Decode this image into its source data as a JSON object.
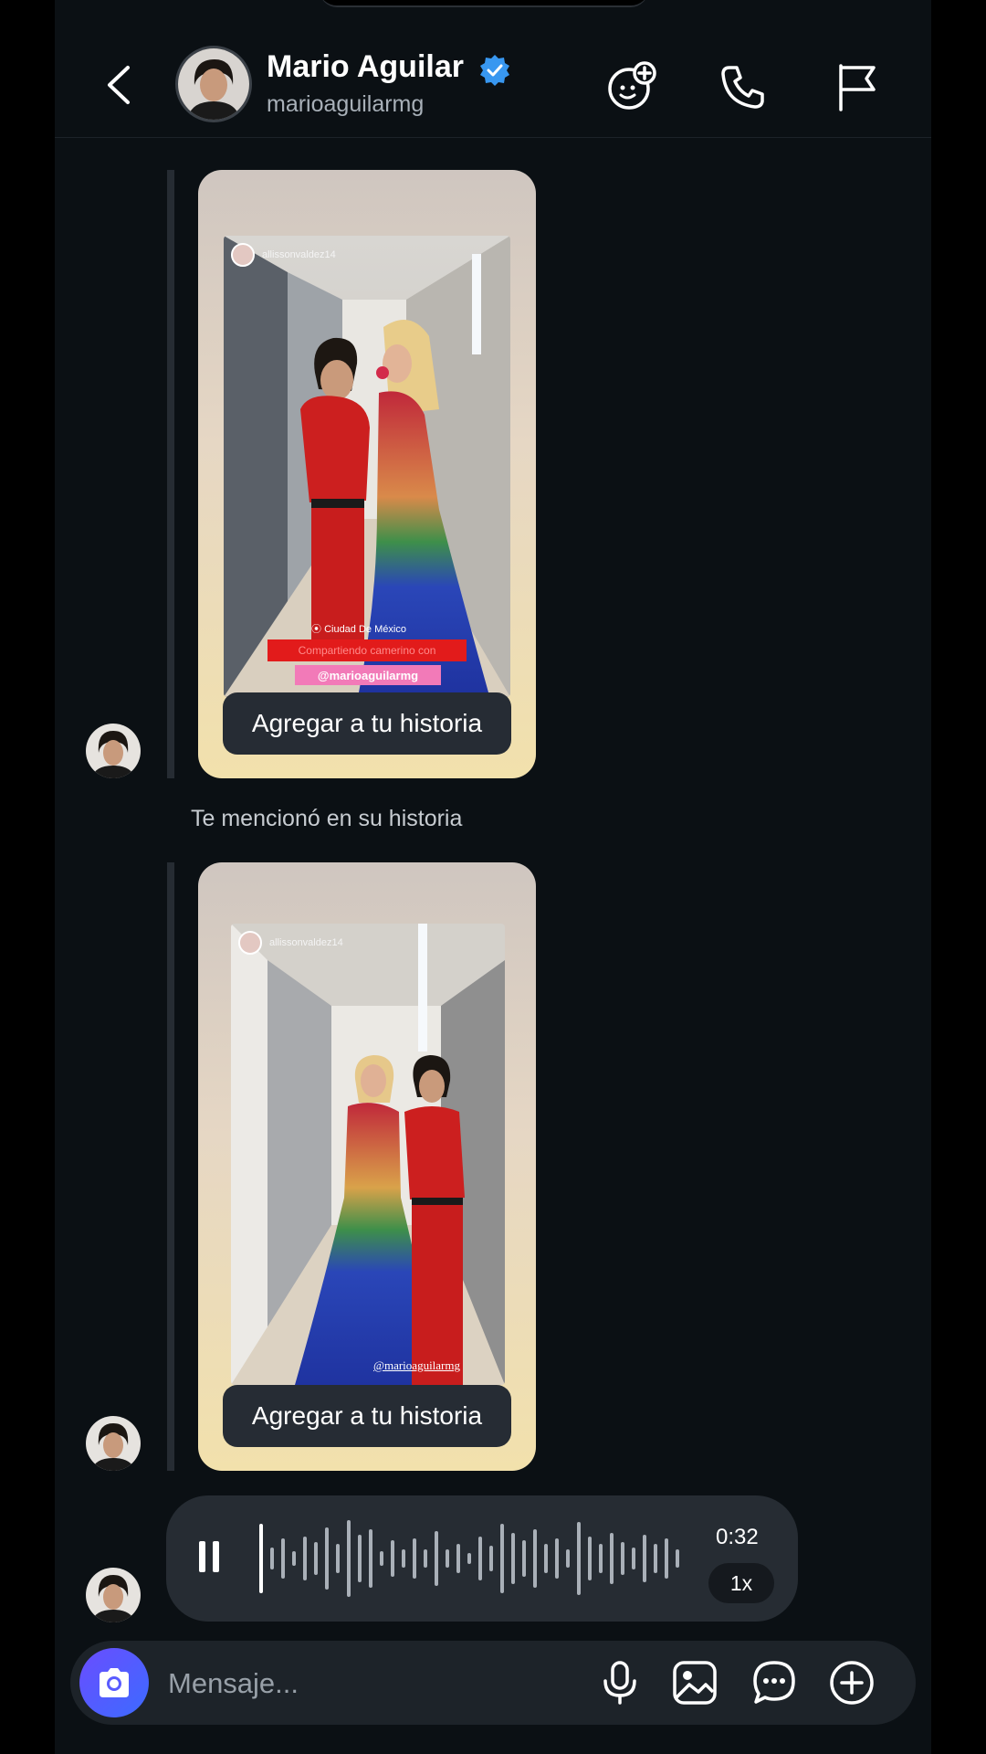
{
  "header": {
    "name": "Mario Aguilar",
    "handle": "marioaguilarmg",
    "verified": true,
    "icons": [
      "back-icon",
      "effects-icon",
      "phone-icon",
      "flag-icon"
    ]
  },
  "messages": [
    {
      "type": "story",
      "story_user": "allissonvaldez14",
      "story_overlay": {
        "location": "Ciudad De México",
        "caption": "Compartiendo camerino con",
        "mention": "@marioaguilarmg"
      },
      "button_label": "Agregar a tu historia"
    },
    {
      "type": "note",
      "text": "Te mencionó en su historia"
    },
    {
      "type": "story",
      "story_user": "allissonvaldez14",
      "story_overlay": {
        "mention": "@marioaguilarmg"
      },
      "button_label": "Agregar a tu historia"
    },
    {
      "type": "voice",
      "duration": "0:32",
      "speed": "1x",
      "state": "playing"
    }
  ],
  "composer": {
    "placeholder": "Mensaje...",
    "icons": [
      "camera-icon",
      "microphone-icon",
      "image-icon",
      "sticker-icon",
      "plus-icon"
    ]
  },
  "colors": {
    "background": "#0b1014",
    "bubble": "#262c33",
    "accent": "#4f5bff",
    "verified": "#3897f0"
  }
}
